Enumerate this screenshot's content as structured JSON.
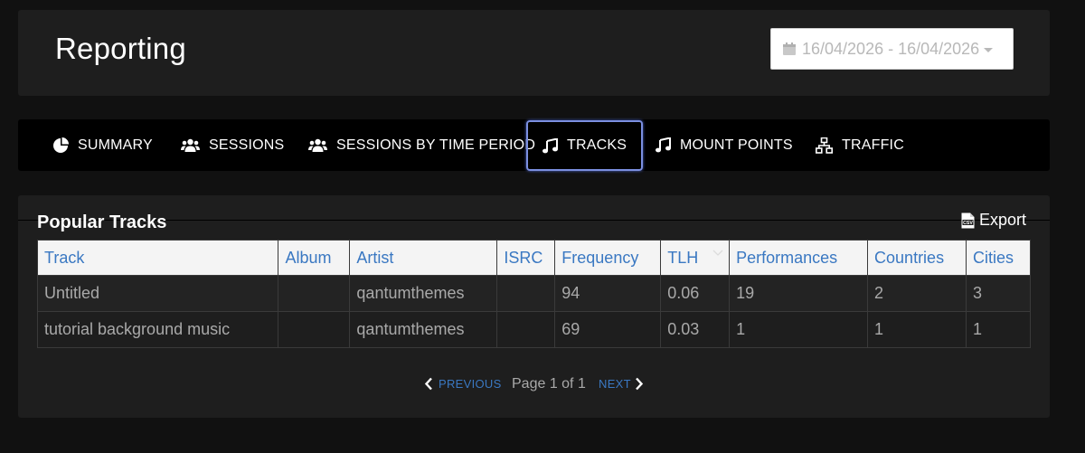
{
  "header": {
    "title": "Reporting",
    "date_range": "16/04/2026 - 16/04/2026"
  },
  "tabs": [
    {
      "label": "SUMMARY",
      "icon": "pie-chart-icon"
    },
    {
      "label": "SESSIONS",
      "icon": "users-icon"
    },
    {
      "label": "SESSIONS BY TIME PERIOD",
      "icon": "users-icon"
    },
    {
      "label": "TRACKS",
      "icon": "music-icon",
      "active": true
    },
    {
      "label": "MOUNT POINTS",
      "icon": "music-icon"
    },
    {
      "label": "TRAFFIC",
      "icon": "sitemap-icon"
    }
  ],
  "section": {
    "title": "Popular Tracks",
    "export_label": "Export",
    "export_icon": "csv-file-icon"
  },
  "table": {
    "columns": [
      "Track",
      "Album",
      "Artist",
      "ISRC",
      "Frequency",
      "TLH",
      "Performances",
      "Countries",
      "Cities"
    ],
    "rows": [
      [
        "Untitled",
        "",
        "qantumthemes",
        "",
        "94",
        "0.06",
        "19",
        "2",
        "3"
      ],
      [
        "tutorial background music",
        "",
        "qantumthemes",
        "",
        "69",
        "0.03",
        "1",
        "1",
        "1"
      ]
    ]
  },
  "pagination": {
    "previous_label": "PREVIOUS",
    "page_info": "Page 1 of 1",
    "next_label": "NEXT"
  },
  "colors": {
    "accent": "#3a78c2",
    "active_tab_border": "#7b8fe0",
    "background": "#111111",
    "panel": "#1e1e1e"
  }
}
